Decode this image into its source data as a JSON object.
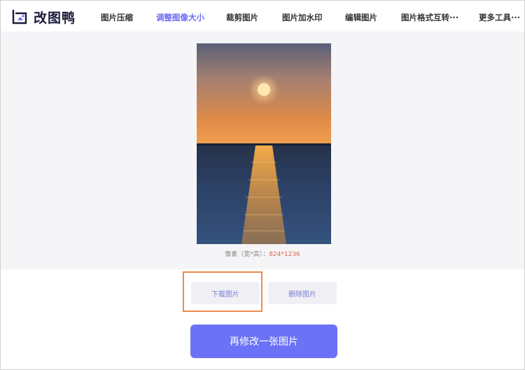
{
  "logo": {
    "text": "改图鸭"
  },
  "nav": {
    "items": [
      {
        "label": "图片压缩"
      },
      {
        "label": "调整图像大小",
        "active": true
      },
      {
        "label": "裁剪图片"
      },
      {
        "label": "图片加水印"
      },
      {
        "label": "编辑图片"
      },
      {
        "label": "图片格式互转···"
      },
      {
        "label": "更多工具···"
      }
    ]
  },
  "preview": {
    "pixel_label": "像素（宽*高）：",
    "pixel_value": "824*1236"
  },
  "actions": {
    "download_label": "下载图片",
    "delete_label": "删除图片",
    "modify_again_label": "再修改一张图片"
  },
  "colors": {
    "accent": "#6b72f5",
    "active_nav": "#6b6cf6",
    "highlight_border": "#ee8a4c",
    "pixel_value": "#e0684b"
  }
}
